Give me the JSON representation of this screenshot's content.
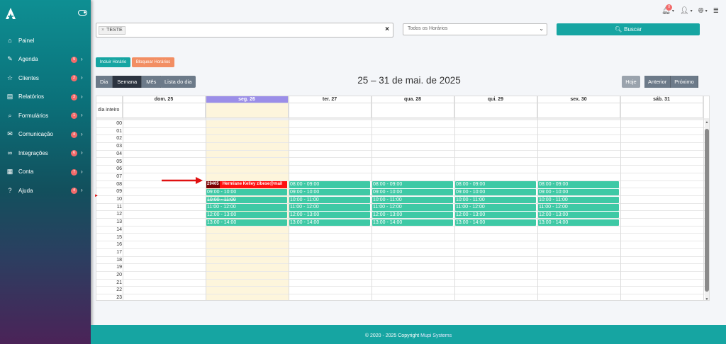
{
  "sidebar": {
    "items": [
      {
        "label": "Painel",
        "icon": "home-icon",
        "glyph": "⌂",
        "badge": ""
      },
      {
        "label": "Agenda",
        "icon": "edit-icon",
        "glyph": "✎",
        "badge": "9"
      },
      {
        "label": "Clientes",
        "icon": "star-icon",
        "glyph": "☆",
        "badge": "2"
      },
      {
        "label": "Relatórios",
        "icon": "book-icon",
        "glyph": "▤",
        "badge": "3"
      },
      {
        "label": "Formulários",
        "icon": "search-icon",
        "glyph": "⌕",
        "badge": "1"
      },
      {
        "label": "Comunicação",
        "icon": "mail-icon",
        "glyph": "✉",
        "badge": "4"
      },
      {
        "label": "Integrações",
        "icon": "link-icon",
        "glyph": "∞",
        "badge": "6"
      },
      {
        "label": "Conta",
        "icon": "briefcase-icon",
        "glyph": "▦",
        "badge": "7"
      },
      {
        "label": "Ajuda",
        "icon": "help-icon",
        "glyph": "?",
        "badge": "4"
      }
    ]
  },
  "header": {
    "notifications_count": "0"
  },
  "search": {
    "tag": "TESTE",
    "select_value": "Todos os Horários",
    "buscar_label": "Buscar"
  },
  "actions": {
    "incluir_label": "Incluir Horário",
    "bloquear_label": "Bloquear Horários"
  },
  "calendar": {
    "views": [
      "Dia",
      "Semana",
      "Mês"
    ],
    "active_view": "Semana",
    "list_label": "Lista do dia",
    "title": "25 – 31 de mai. de 2025",
    "today_label": "Hoje",
    "prev_label": "Anterior",
    "next_label": "Próximo",
    "allday_label": "dia inteiro",
    "days": [
      "dom. 25",
      "seg. 26",
      "ter. 27",
      "qua. 28",
      "qui. 29",
      "sex. 30",
      "sáb. 31"
    ],
    "today_index": 1,
    "hours": [
      "00",
      "01",
      "02",
      "03",
      "04",
      "05",
      "06",
      "07",
      "08",
      "09",
      "10",
      "11",
      "12",
      "13",
      "14",
      "15",
      "16",
      "17",
      "18",
      "19",
      "20",
      "21",
      "22",
      "23"
    ],
    "slots": [
      "08:00 - 09:00",
      "09:00 - 10:00",
      "10:00 - 11:00",
      "11:00 - 12:00",
      "12:00 - 13:00",
      "13:00 - 14:00"
    ],
    "booked_event": {
      "id": "29405",
      "label": "Hermiane Kelley zibese@mail"
    },
    "colors": {
      "slot": "#3ec9a5",
      "booked": "#ff1010",
      "today_header": "#9b8ee8",
      "today_bg": "#fdf5dc"
    }
  },
  "footer": {
    "text": "© 2020 - 2025 Copyright",
    "brand": "Mupi Systems"
  }
}
